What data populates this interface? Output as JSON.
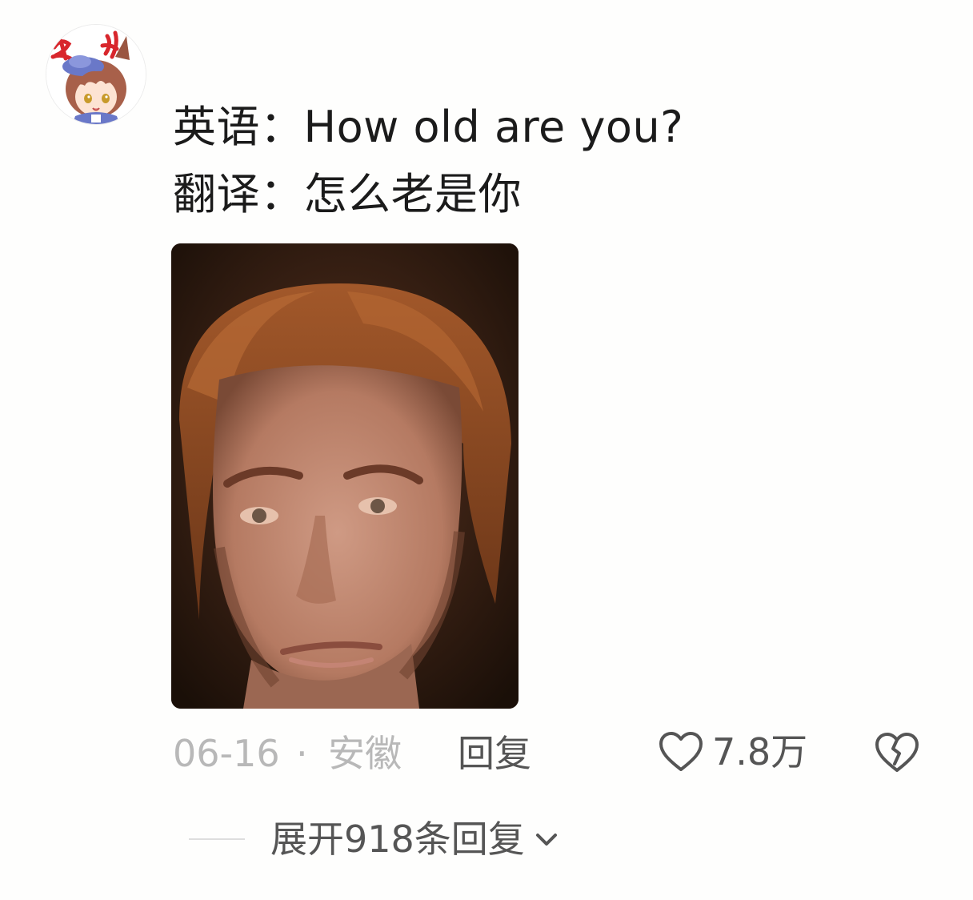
{
  "comment": {
    "line1": "英语：How old are you?",
    "line2": "翻译：怎么老是你",
    "date": "06-16",
    "separator": "·",
    "location": "安徽",
    "reply_label": "回复",
    "like_count": "7.8万",
    "expand_label": "展开918条回复"
  },
  "icons": {
    "avatar": "anime-girl-avatar",
    "photo": "meme-face-photo",
    "like": "heart-outline-icon",
    "dislike": "broken-heart-icon",
    "expand": "chevron-down-icon"
  },
  "colors": {
    "background": "#fefefd",
    "text_primary": "#1b1b1b",
    "text_secondary": "#555555",
    "text_muted": "#b8b8b8",
    "avatar_script": "#d8262c"
  }
}
